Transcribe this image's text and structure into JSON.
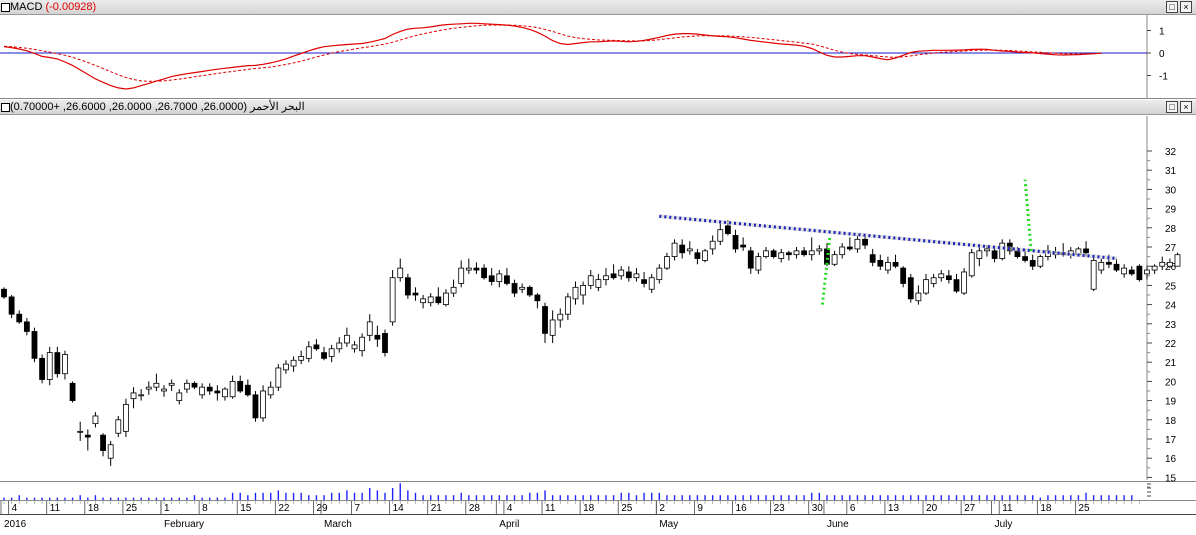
{
  "macd_panel": {
    "title": "MACD",
    "value": "(-0.00928)",
    "yticks": [
      "1",
      "0",
      "-1"
    ]
  },
  "price_panel": {
    "title": "البحر الأحمر",
    "ohlc": "(26.0000, 26.7000, 26.0000, 26.6000, +0.70000)"
  },
  "window_buttons": [
    "□",
    "×"
  ],
  "x_labels": [
    {
      "t": "2016",
      "dayIndex": 0
    },
    {
      "t": "4",
      "dayIndex": 1
    },
    {
      "t": "11",
      "dayIndex": 6
    },
    {
      "t": "18",
      "dayIndex": 11
    },
    {
      "t": "25",
      "dayIndex": 16
    },
    {
      "t": "1",
      "dayIndex": 21
    },
    {
      "t": "February",
      "dayIndex": 21
    },
    {
      "t": "8",
      "dayIndex": 26
    },
    {
      "t": "15",
      "dayIndex": 31
    },
    {
      "t": "22",
      "dayIndex": 36
    },
    {
      "t": "29",
      "dayIndex": 41
    },
    {
      "t": "March",
      "dayIndex": 42
    },
    {
      "t": "7",
      "dayIndex": 46
    },
    {
      "t": "14",
      "dayIndex": 51
    },
    {
      "t": "21",
      "dayIndex": 56
    },
    {
      "t": "28",
      "dayIndex": 61
    },
    {
      "t": "April",
      "dayIndex": 65
    },
    {
      "t": "4",
      "dayIndex": 66
    },
    {
      "t": "11",
      "dayIndex": 71
    },
    {
      "t": "18",
      "dayIndex": 76
    },
    {
      "t": "25",
      "dayIndex": 81
    },
    {
      "t": "May",
      "dayIndex": 86
    },
    {
      "t": "2",
      "dayIndex": 86
    },
    {
      "t": "9",
      "dayIndex": 91
    },
    {
      "t": "16",
      "dayIndex": 96
    },
    {
      "t": "23",
      "dayIndex": 101
    },
    {
      "t": "30",
      "dayIndex": 106
    },
    {
      "t": "June",
      "dayIndex": 108
    },
    {
      "t": "6",
      "dayIndex": 111
    },
    {
      "t": "13",
      "dayIndex": 116
    },
    {
      "t": "20",
      "dayIndex": 121
    },
    {
      "t": "27",
      "dayIndex": 126
    },
    {
      "t": "July",
      "dayIndex": 130
    },
    {
      "t": "11",
      "dayIndex": 131
    },
    {
      "t": "18",
      "dayIndex": 136
    },
    {
      "t": "25",
      "dayIndex": 141
    }
  ],
  "chart_data": {
    "type": "candlestick",
    "ylim": [
      14.5,
      33
    ],
    "yticks": [
      15,
      16,
      17,
      18,
      19,
      20,
      21,
      22,
      23,
      24,
      25,
      26,
      27,
      28,
      29,
      30,
      31,
      32
    ],
    "candles": [
      [
        24.8,
        24.9,
        24.3,
        24.4
      ],
      [
        24.4,
        24.5,
        23.3,
        23.5
      ],
      [
        23.5,
        23.7,
        23.0,
        23.1
      ],
      [
        23.1,
        23.3,
        22.4,
        22.6
      ],
      [
        22.6,
        22.8,
        21.0,
        21.2
      ],
      [
        21.2,
        21.4,
        19.9,
        20.1
      ],
      [
        20.1,
        21.8,
        19.8,
        21.5
      ],
      [
        21.5,
        21.8,
        20.2,
        20.4
      ],
      [
        20.4,
        21.6,
        20.1,
        21.4
      ],
      [
        19.9,
        20.0,
        18.9,
        19.0
      ],
      [
        17.4,
        17.9,
        16.9,
        17.4
      ],
      [
        17.2,
        17.5,
        16.4,
        17.1
      ],
      [
        17.8,
        18.4,
        17.6,
        18.2
      ],
      [
        17.2,
        17.3,
        16.1,
        16.4
      ],
      [
        16.0,
        16.9,
        15.6,
        16.7
      ],
      [
        17.3,
        18.2,
        17.1,
        18.0
      ],
      [
        17.4,
        19.1,
        17.1,
        18.8
      ],
      [
        19.1,
        19.7,
        18.6,
        19.4
      ],
      [
        19.3,
        19.6,
        19.0,
        19.3
      ],
      [
        19.6,
        20.0,
        19.3,
        19.7
      ],
      [
        19.7,
        20.4,
        19.5,
        19.9
      ],
      [
        19.5,
        19.8,
        19.2,
        19.6
      ],
      [
        19.8,
        20.1,
        19.5,
        19.9
      ],
      [
        19.0,
        19.6,
        18.8,
        19.4
      ],
      [
        19.6,
        20.1,
        19.4,
        19.9
      ],
      [
        19.9,
        20.0,
        19.6,
        19.7
      ],
      [
        19.3,
        19.9,
        19.1,
        19.7
      ],
      [
        19.7,
        19.9,
        19.3,
        19.5
      ],
      [
        19.5,
        19.8,
        19.0,
        19.4
      ],
      [
        19.2,
        19.7,
        19.0,
        19.6
      ],
      [
        19.2,
        20.3,
        19.1,
        20.0
      ],
      [
        20.0,
        20.3,
        19.4,
        19.5
      ],
      [
        19.8,
        20.1,
        19.2,
        19.3
      ],
      [
        19.3,
        19.5,
        17.9,
        18.1
      ],
      [
        18.1,
        19.8,
        17.9,
        19.5
      ],
      [
        19.3,
        20.0,
        19.1,
        19.7
      ],
      [
        19.7,
        20.9,
        19.5,
        20.7
      ],
      [
        20.6,
        21.1,
        20.4,
        20.9
      ],
      [
        20.8,
        21.3,
        20.5,
        21.1
      ],
      [
        21.1,
        21.6,
        20.9,
        21.3
      ],
      [
        21.2,
        22.1,
        21.0,
        21.8
      ],
      [
        21.9,
        22.2,
        21.6,
        21.7
      ],
      [
        21.5,
        21.8,
        21.1,
        21.2
      ],
      [
        21.3,
        21.9,
        21.0,
        21.7
      ],
      [
        21.7,
        22.3,
        21.5,
        22.0
      ],
      [
        22.0,
        22.8,
        21.8,
        22.4
      ],
      [
        21.7,
        22.1,
        21.5,
        21.9
      ],
      [
        21.6,
        22.5,
        21.3,
        22.3
      ],
      [
        22.4,
        23.5,
        22.1,
        23.1
      ],
      [
        22.4,
        22.9,
        21.8,
        22.2
      ],
      [
        22.5,
        22.7,
        21.3,
        21.5
      ],
      [
        23.1,
        25.8,
        22.9,
        25.4
      ],
      [
        25.4,
        26.4,
        25.2,
        25.9
      ],
      [
        25.4,
        25.6,
        24.3,
        24.5
      ],
      [
        24.6,
        24.9,
        24.2,
        24.5
      ],
      [
        24.1,
        24.5,
        23.8,
        24.3
      ],
      [
        24.1,
        24.6,
        23.9,
        24.4
      ],
      [
        24.4,
        24.9,
        24.0,
        24.1
      ],
      [
        24.0,
        24.8,
        23.9,
        24.6
      ],
      [
        24.6,
        25.3,
        24.4,
        24.9
      ],
      [
        25.1,
        26.3,
        24.9,
        25.9
      ],
      [
        25.8,
        26.4,
        25.6,
        25.9
      ],
      [
        25.9,
        26.2,
        25.6,
        25.8
      ],
      [
        25.9,
        26.1,
        25.3,
        25.4
      ],
      [
        25.5,
        25.9,
        25.0,
        25.2
      ],
      [
        25.2,
        25.8,
        24.9,
        25.6
      ],
      [
        25.5,
        25.9,
        25.0,
        25.1
      ],
      [
        25.1,
        25.3,
        24.4,
        24.6
      ],
      [
        24.8,
        25.1,
        24.6,
        24.9
      ],
      [
        24.9,
        25.0,
        24.4,
        24.5
      ],
      [
        24.5,
        24.6,
        23.8,
        24.2
      ],
      [
        23.9,
        24.1,
        22.0,
        22.5
      ],
      [
        22.4,
        23.7,
        22.0,
        23.2
      ],
      [
        23.2,
        23.8,
        22.8,
        23.5
      ],
      [
        23.5,
        24.6,
        23.2,
        24.4
      ],
      [
        24.3,
        25.2,
        24.0,
        24.9
      ],
      [
        24.5,
        25.2,
        24.0,
        25.0
      ],
      [
        25.0,
        25.8,
        24.8,
        25.5
      ],
      [
        24.9,
        25.6,
        24.7,
        25.3
      ],
      [
        25.3,
        25.9,
        25.0,
        25.5
      ],
      [
        25.6,
        26.1,
        25.3,
        25.4
      ],
      [
        25.5,
        26.0,
        25.3,
        25.8
      ],
      [
        25.7,
        26.0,
        25.2,
        25.4
      ],
      [
        25.4,
        25.9,
        25.2,
        25.6
      ],
      [
        25.3,
        25.7,
        24.9,
        25.1
      ],
      [
        24.8,
        25.6,
        24.6,
        25.4
      ],
      [
        25.3,
        26.1,
        25.1,
        25.9
      ],
      [
        25.9,
        26.7,
        25.8,
        26.5
      ],
      [
        26.5,
        27.4,
        26.3,
        27.2
      ],
      [
        27.1,
        27.4,
        26.4,
        26.7
      ],
      [
        26.8,
        27.3,
        26.6,
        26.9
      ],
      [
        26.7,
        26.9,
        26.1,
        26.4
      ],
      [
        26.3,
        26.9,
        26.2,
        26.8
      ],
      [
        26.9,
        27.6,
        26.6,
        27.3
      ],
      [
        27.3,
        28.3,
        27.1,
        27.9
      ],
      [
        28.1,
        28.4,
        27.6,
        27.7
      ],
      [
        27.6,
        27.9,
        26.7,
        26.9
      ],
      [
        27.1,
        27.5,
        26.8,
        27.0
      ],
      [
        26.8,
        27.0,
        25.6,
        25.9
      ],
      [
        25.8,
        26.7,
        25.6,
        26.5
      ],
      [
        26.5,
        27.0,
        26.4,
        26.8
      ],
      [
        26.8,
        26.9,
        26.4,
        26.5
      ],
      [
        26.4,
        26.9,
        26.2,
        26.7
      ],
      [
        26.7,
        26.8,
        26.3,
        26.6
      ],
      [
        26.6,
        27.0,
        26.4,
        26.8
      ],
      [
        26.8,
        27.0,
        26.5,
        26.6
      ],
      [
        26.6,
        27.5,
        26.3,
        26.8
      ],
      [
        26.8,
        27.1,
        26.6,
        26.9
      ],
      [
        26.9,
        27.2,
        26.0,
        26.1
      ],
      [
        26.1,
        26.8,
        26.0,
        26.6
      ],
      [
        26.6,
        27.2,
        26.4,
        27.0
      ],
      [
        27.0,
        27.5,
        26.8,
        26.9
      ],
      [
        26.9,
        27.6,
        26.7,
        27.4
      ],
      [
        27.4,
        27.7,
        26.9,
        27.1
      ],
      [
        26.6,
        26.9,
        26.0,
        26.2
      ],
      [
        26.3,
        26.6,
        25.8,
        26.0
      ],
      [
        25.8,
        26.5,
        25.6,
        26.2
      ],
      [
        26.2,
        26.6,
        25.9,
        26.0
      ],
      [
        25.9,
        26.0,
        24.9,
        25.1
      ],
      [
        25.4,
        25.6,
        24.1,
        24.3
      ],
      [
        24.2,
        25.0,
        24.0,
        24.6
      ],
      [
        24.6,
        25.6,
        24.5,
        25.3
      ],
      [
        25.1,
        25.6,
        24.9,
        25.4
      ],
      [
        25.4,
        25.8,
        25.2,
        25.6
      ],
      [
        25.5,
        25.8,
        25.1,
        25.3
      ],
      [
        25.3,
        25.6,
        24.6,
        24.7
      ],
      [
        24.6,
        25.9,
        24.5,
        25.7
      ],
      [
        25.5,
        26.9,
        25.4,
        26.7
      ],
      [
        26.4,
        27.0,
        26.0,
        26.8
      ],
      [
        26.8,
        27.1,
        26.5,
        26.9
      ],
      [
        26.8,
        27.0,
        26.2,
        26.4
      ],
      [
        26.4,
        27.4,
        26.3,
        27.2
      ],
      [
        27.2,
        27.4,
        26.6,
        26.8
      ],
      [
        26.8,
        27.0,
        26.4,
        26.5
      ],
      [
        26.5,
        26.9,
        26.2,
        26.3
      ],
      [
        26.3,
        26.6,
        25.8,
        26.0
      ],
      [
        26.0,
        26.6,
        25.9,
        26.5
      ],
      [
        26.5,
        27.1,
        26.3,
        26.8
      ],
      [
        26.6,
        27.0,
        26.4,
        26.7
      ],
      [
        26.7,
        27.2,
        26.5,
        26.6
      ],
      [
        26.6,
        27.0,
        26.4,
        26.8
      ],
      [
        26.6,
        27.0,
        26.5,
        26.9
      ],
      [
        26.9,
        27.3,
        26.5,
        26.7
      ],
      [
        24.8,
        26.5,
        24.7,
        26.3
      ],
      [
        25.8,
        26.4,
        25.6,
        26.2
      ],
      [
        26.2,
        26.6,
        25.9,
        26.1
      ],
      [
        26.1,
        26.4,
        25.7,
        25.8
      ],
      [
        25.6,
        26.1,
        25.4,
        25.9
      ],
      [
        25.8,
        26.0,
        25.5,
        25.6
      ],
      [
        26.0,
        26.1,
        25.2,
        25.3
      ],
      [
        25.6,
        26.0,
        25.3,
        25.8
      ],
      [
        25.8,
        26.1,
        25.6,
        26.0
      ],
      [
        26.0,
        26.5,
        25.8,
        26.2
      ],
      [
        26.0,
        26.4,
        25.9,
        26.2
      ],
      [
        26.0,
        26.7,
        26.0,
        26.6
      ]
    ],
    "annotations": {
      "resistance_line": {
        "from": [
          86,
          28.6
        ],
        "to": [
          145,
          26.4
        ],
        "color": "#1b22b8",
        "style": "dotted"
      },
      "target_lines": [
        {
          "from": [
            107.4,
            24.0
          ],
          "to": [
            108.4,
            27.6
          ],
          "color": "#22dd22"
        },
        {
          "from": [
            134.8,
            26.8
          ],
          "to": [
            134.0,
            30.5
          ],
          "color": "#22dd22"
        }
      ]
    },
    "macd": {
      "ylim": [
        -1.8,
        1.8
      ],
      "macd_line": [
        0.28,
        0.24,
        0.18,
        0.1,
        -0.02,
        -0.15,
        -0.2,
        -0.26,
        -0.4,
        -0.55,
        -0.75,
        -0.95,
        -1.15,
        -1.3,
        -1.45,
        -1.55,
        -1.6,
        -1.55,
        -1.45,
        -1.35,
        -1.25,
        -1.15,
        -1.05,
        -0.98,
        -0.92,
        -0.87,
        -0.82,
        -0.77,
        -0.72,
        -0.68,
        -0.64,
        -0.6,
        -0.56,
        -0.55,
        -0.5,
        -0.44,
        -0.36,
        -0.26,
        -0.14,
        -0.02,
        0.1,
        0.2,
        0.28,
        0.32,
        0.35,
        0.38,
        0.4,
        0.42,
        0.48,
        0.56,
        0.65,
        0.82,
        0.96,
        1.06,
        1.1,
        1.12,
        1.16,
        1.22,
        1.26,
        1.28,
        1.3,
        1.32,
        1.32,
        1.3,
        1.28,
        1.26,
        1.24,
        1.2,
        1.14,
        1.05,
        0.92,
        0.75,
        0.55,
        0.42,
        0.38,
        0.42,
        0.46,
        0.5,
        0.5,
        0.52,
        0.54,
        0.52,
        0.5,
        0.52,
        0.56,
        0.62,
        0.7,
        0.78,
        0.84,
        0.86,
        0.86,
        0.84,
        0.8,
        0.76,
        0.74,
        0.72,
        0.68,
        0.62,
        0.56,
        0.52,
        0.48,
        0.44,
        0.4,
        0.38,
        0.35,
        0.3,
        0.2,
        0.05,
        -0.1,
        -0.18,
        -0.18,
        -0.15,
        -0.12,
        -0.12,
        -0.18,
        -0.25,
        -0.3,
        -0.22,
        -0.1,
        0.02,
        0.08,
        0.1,
        0.12,
        0.12,
        0.12,
        0.13,
        0.14,
        0.16,
        0.17,
        0.16,
        0.12,
        0.09,
        0.07,
        0.04,
        0.02,
        0.01,
        -0.02,
        -0.05,
        -0.08,
        -0.09,
        -0.08,
        -0.07,
        -0.05,
        -0.03,
        -0.01
      ],
      "signal_line": [
        0.3,
        0.28,
        0.25,
        0.21,
        0.16,
        0.1,
        0.04,
        -0.03,
        -0.1,
        -0.19,
        -0.3,
        -0.42,
        -0.55,
        -0.69,
        -0.83,
        -0.97,
        -1.09,
        -1.18,
        -1.24,
        -1.26,
        -1.26,
        -1.24,
        -1.2,
        -1.16,
        -1.11,
        -1.06,
        -1.01,
        -0.96,
        -0.91,
        -0.86,
        -0.82,
        -0.77,
        -0.73,
        -0.69,
        -0.66,
        -0.62,
        -0.57,
        -0.51,
        -0.44,
        -0.36,
        -0.27,
        -0.18,
        -0.09,
        -0.01,
        0.06,
        0.12,
        0.18,
        0.23,
        0.28,
        0.34,
        0.4,
        0.48,
        0.58,
        0.68,
        0.77,
        0.85,
        0.92,
        0.99,
        1.05,
        1.1,
        1.14,
        1.18,
        1.21,
        1.23,
        1.24,
        1.24,
        1.24,
        1.23,
        1.21,
        1.18,
        1.13,
        1.05,
        0.96,
        0.85,
        0.75,
        0.68,
        0.64,
        0.61,
        0.58,
        0.57,
        0.56,
        0.55,
        0.54,
        0.54,
        0.54,
        0.56,
        0.59,
        0.63,
        0.67,
        0.71,
        0.74,
        0.76,
        0.77,
        0.77,
        0.77,
        0.76,
        0.74,
        0.72,
        0.69,
        0.66,
        0.62,
        0.59,
        0.55,
        0.52,
        0.48,
        0.44,
        0.4,
        0.32,
        0.22,
        0.12,
        0.04,
        -0.02,
        -0.06,
        -0.09,
        -0.12,
        -0.15,
        -0.18,
        -0.19,
        -0.17,
        -0.13,
        -0.08,
        -0.04,
        0.0,
        0.03,
        0.05,
        0.07,
        0.09,
        0.11,
        0.12,
        0.13,
        0.13,
        0.12,
        0.11,
        0.09,
        0.07,
        0.05,
        0.03,
        0.01,
        -0.01,
        -0.03,
        -0.04,
        -0.04,
        -0.04,
        -0.03,
        -0.02
      ]
    },
    "volume": [
      1,
      1,
      2,
      1,
      1,
      1,
      1,
      1,
      1,
      1,
      2,
      1,
      2,
      1,
      1,
      1,
      1,
      1,
      1,
      1,
      1,
      1,
      1,
      1,
      1,
      2,
      1,
      1,
      1,
      1,
      3,
      3,
      2,
      3,
      3,
      3,
      4,
      3,
      3,
      3,
      2,
      2,
      2,
      3,
      3,
      4,
      3,
      3,
      5,
      4,
      3,
      5,
      7,
      4,
      3,
      2,
      2,
      2,
      2,
      2,
      3,
      2,
      2,
      2,
      2,
      2,
      2,
      2,
      2,
      3,
      3,
      4,
      2,
      2,
      2,
      2,
      2,
      2,
      2,
      2,
      2,
      3,
      3,
      2,
      3,
      3,
      3,
      2,
      2,
      2,
      2,
      2,
      2,
      2,
      2,
      2,
      2,
      2,
      2,
      2,
      2,
      2,
      2,
      2,
      2,
      2,
      3,
      3,
      2,
      2,
      2,
      2,
      2,
      2,
      2,
      2,
      2,
      2,
      2,
      2,
      2,
      2,
      2,
      2,
      2,
      2,
      2,
      2,
      2,
      2,
      2,
      2,
      2,
      2,
      2,
      2,
      1,
      2,
      2,
      2,
      2,
      2,
      3,
      2,
      2,
      2,
      2,
      2,
      2
    ]
  }
}
